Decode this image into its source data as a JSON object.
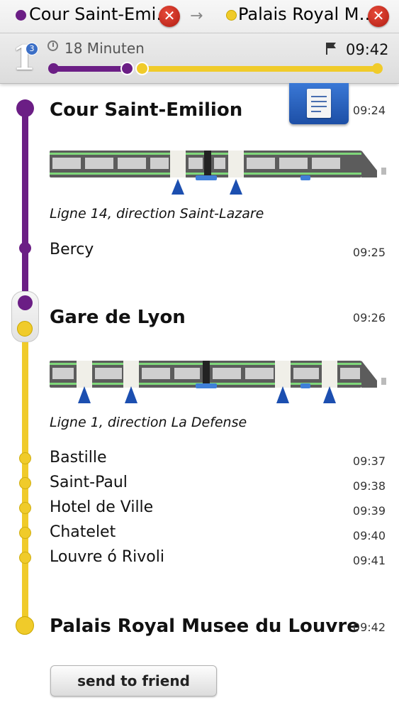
{
  "header": {
    "from_station": "Cour Saint-Emi…",
    "to_station": "Palais Royal M…",
    "line_number": "1",
    "line_badge_count": "3",
    "duration": "18 Minuten",
    "arrival_time": "09:42",
    "colors": {
      "line14": "#6b1e85",
      "line1": "#f0cb2a"
    }
  },
  "itinerary": {
    "start": {
      "name": "Cour Saint-Emilion",
      "time": "09:24"
    },
    "leg1_direction": "Ligne 14, direction Saint-Lazare",
    "stops_leg1": [
      {
        "name": "Bercy",
        "time": "09:25"
      }
    ],
    "transfer": {
      "name": "Gare de Lyon",
      "time": "09:26"
    },
    "leg2_direction": "Ligne 1, direction La Defense",
    "stops_leg2": [
      {
        "name": "Bastille",
        "time": "09:37"
      },
      {
        "name": "Saint-Paul",
        "time": "09:38"
      },
      {
        "name": "Hotel de Ville",
        "time": "09:39"
      },
      {
        "name": "Chatelet",
        "time": "09:40"
      },
      {
        "name": "Louvre ó Rivoli",
        "time": "09:41"
      }
    ],
    "end": {
      "name": "Palais Royal Musee du Louvre",
      "time": "09:42"
    }
  },
  "actions": {
    "send_to_friend": "send to friend"
  }
}
